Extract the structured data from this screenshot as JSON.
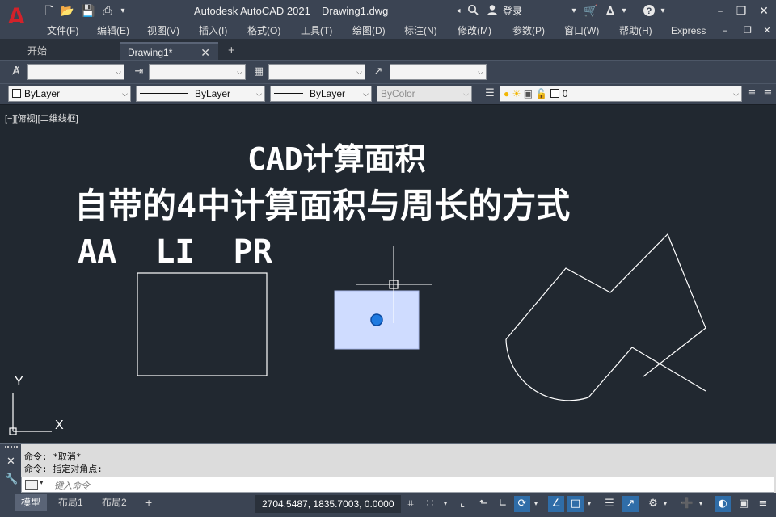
{
  "app": {
    "title": "Autodesk AutoCAD 2021",
    "document": "Drawing1.dwg",
    "signin": "登录",
    "logo_letter": "A"
  },
  "menu": [
    "文件(F)",
    "编辑(E)",
    "视图(V)",
    "插入(I)",
    "格式(O)",
    "工具(T)",
    "绘图(D)",
    "标注(N)",
    "修改(M)",
    "参数(P)",
    "窗口(W)",
    "帮助(H)",
    "Express"
  ],
  "tabs": [
    {
      "label": "开始",
      "active": false
    },
    {
      "label": "Drawing1*",
      "active": true
    }
  ],
  "properties": {
    "color": "ByLayer",
    "linetype": "ByLayer",
    "lineweight": "ByLayer",
    "plotstyle": "ByColor",
    "layer": "0"
  },
  "viewport_label": "[−][俯视][二维线框]",
  "drawing": {
    "title": "CAD计算面积",
    "subtitle": "自带的4中计算面积与周长的方式",
    "commands": "AA  LI  PR",
    "ucs_x": "X",
    "ucs_y": "Y"
  },
  "command_history": [
    "命令: *取消*",
    "命令: 指定对角点:"
  ],
  "command_placeholder": "键入命令",
  "layout_tabs": [
    {
      "label": "模型",
      "active": true
    },
    {
      "label": "布局1",
      "active": false
    },
    {
      "label": "布局2",
      "active": false
    }
  ],
  "coordinates": "2704.5487, 1835.7003, 0.0000",
  "colors": {
    "canvas": "#212830",
    "chrome": "#3b4453",
    "selection_fill": "#cfdcff",
    "grip": "#1f7ae0",
    "logo": "#d2222a"
  }
}
